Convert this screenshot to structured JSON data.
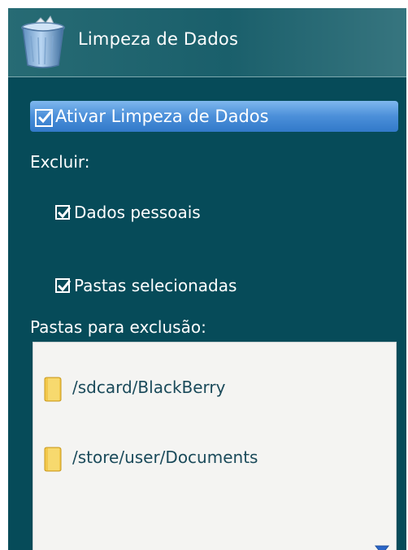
{
  "header": {
    "title": "Limpeza de Dados",
    "icon": "trash-bin-icon"
  },
  "settings": {
    "enable_label": "Ativar Limpeza de Dados",
    "enable_checked": true,
    "exclude_label": "Excluir:",
    "options": [
      {
        "label": "Dados pessoais",
        "checked": true
      },
      {
        "label": "Pastas selecionadas",
        "checked": true
      }
    ],
    "folders_label": "Pastas para exclusão:",
    "folders": [
      {
        "path": "/sdcard/BlackBerry",
        "icon": "folder-icon"
      },
      {
        "path": "/store/user/Documents",
        "icon": "folder-icon"
      }
    ]
  },
  "colors": {
    "background": "#064b59",
    "highlight": "#4b8fd9",
    "list_background": "#f4f4f2",
    "folder_text": "#1a4a5a",
    "scroll_arrow": "#2a66c8"
  }
}
